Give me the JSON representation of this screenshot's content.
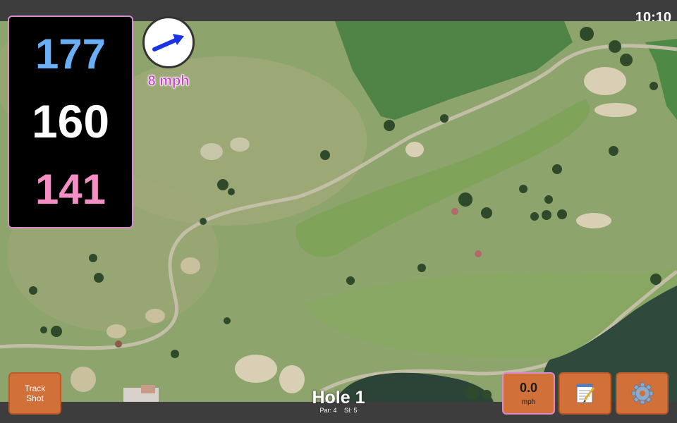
{
  "status_bar": {
    "time": "10:10"
  },
  "distances": {
    "back": "177",
    "center": "160",
    "front": "141"
  },
  "wind": {
    "speed_label": "8 mph",
    "direction_icon": "wind-arrow-icon"
  },
  "hole": {
    "title": "Hole 1",
    "par": "Par: 4",
    "si": "SI: 5"
  },
  "buttons": {
    "track_shot": {
      "line1": "Track",
      "line2": "Shot"
    },
    "speed": {
      "value": "0.0",
      "unit": "mph"
    },
    "notes_icon": "notepad-icon",
    "settings_icon": "gear-icon"
  },
  "colors": {
    "back_distance": "#6aaef5",
    "center_distance": "#ffffff",
    "front_distance": "#f58ec4",
    "wind_text": "#cc3fc6",
    "button": "#d2703a",
    "panel_border": "#d98bcf"
  }
}
